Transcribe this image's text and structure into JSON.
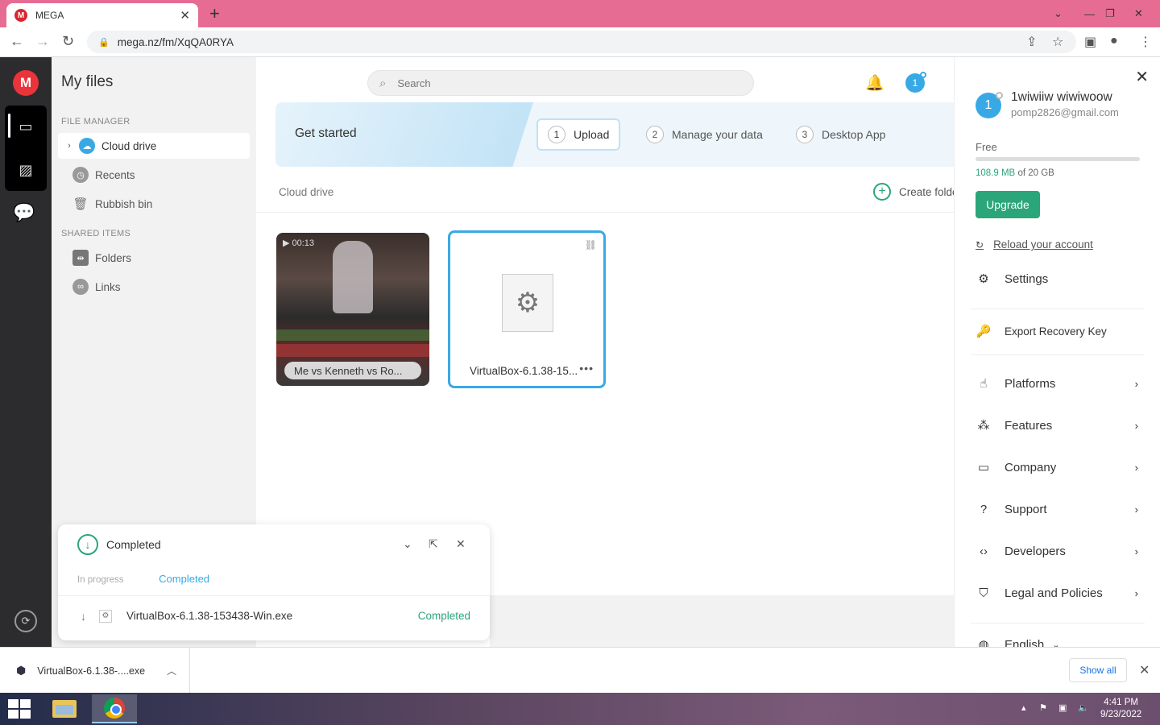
{
  "browser": {
    "tab_title": "MEGA",
    "favicon_letter": "M",
    "url": "mega.nz/fm/XqQA0RYA"
  },
  "sidebar": {
    "title": "My files",
    "section_file_manager": "FILE MANAGER",
    "section_shared": "SHARED ITEMS",
    "items": [
      {
        "label": "Cloud drive",
        "icon": "cloud-icon"
      },
      {
        "label": "Recents",
        "icon": "clock-icon"
      },
      {
        "label": "Rubbish bin",
        "icon": "trash-icon"
      },
      {
        "label": "Folders",
        "icon": "shared-folder-icon"
      },
      {
        "label": "Links",
        "icon": "link-icon"
      }
    ]
  },
  "header": {
    "search_placeholder": "Search",
    "avatar_initial": "1"
  },
  "get_started": {
    "title": "Get started",
    "steps": [
      {
        "num": "1",
        "label": "Upload"
      },
      {
        "num": "2",
        "label": "Manage your data"
      },
      {
        "num": "3",
        "label": "Desktop App"
      }
    ]
  },
  "main": {
    "breadcrumb": "Cloud drive",
    "create_folder": "Create folder",
    "files": [
      {
        "name": "Me vs Kenneth vs Ro...",
        "duration": "00:13",
        "type": "video"
      },
      {
        "name": "VirtualBox-6.1.38-15...",
        "type": "exe"
      }
    ]
  },
  "transfers": {
    "title": "Completed",
    "tab_in_progress": "In progress",
    "tab_completed": "Completed",
    "rows": [
      {
        "name": "VirtualBox-6.1.38-153438-Win.exe",
        "status": "Completed"
      }
    ]
  },
  "account": {
    "avatar_initial": "1",
    "name": "1wiwiiw wiwiwoow",
    "email": "pomp2826@gmail.com",
    "plan": "Free",
    "used": "108.9 MB",
    "total": "of 20 GB",
    "used_fraction": 0.005,
    "upgrade": "Upgrade",
    "reload": "Reload your account",
    "menu": [
      {
        "label": "Settings",
        "icon": "gear-icon"
      },
      {
        "label": "Export Recovery Key",
        "icon": "key-icon"
      },
      {
        "label": "Platforms",
        "icon": "touch-icon"
      },
      {
        "label": "Features",
        "icon": "features-icon"
      },
      {
        "label": "Company",
        "icon": "briefcase-icon"
      },
      {
        "label": "Support",
        "icon": "help-icon"
      },
      {
        "label": "Developers",
        "icon": "code-icon"
      },
      {
        "label": "Legal and Policies",
        "icon": "shield-icon"
      },
      {
        "label": "English",
        "icon": "globe-icon"
      }
    ]
  },
  "download_bar": {
    "file": "VirtualBox-6.1.38-....exe",
    "show_all": "Show all"
  },
  "taskbar": {
    "time": "4:41 PM",
    "date": "9/23/2022"
  },
  "colors": {
    "accent_blue": "#39a9e6",
    "accent_green": "#2ba57a",
    "mega_red": "#e8343a",
    "tab_bar": "#e76c93"
  }
}
